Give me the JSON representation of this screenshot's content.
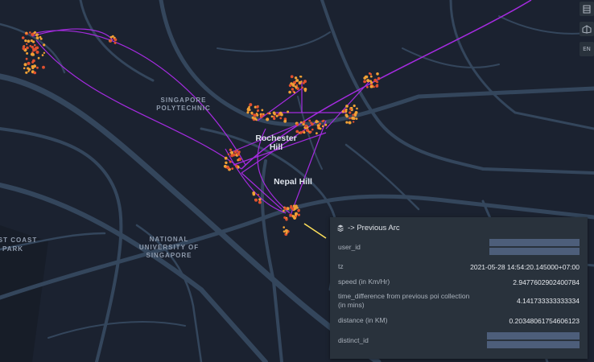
{
  "map": {
    "places": [
      {
        "text": "SINGAPORE",
        "kind": "area"
      },
      {
        "text": "POLYTECHNIC",
        "kind": "area"
      },
      {
        "text": "NATIONAL",
        "kind": "area"
      },
      {
        "text": "UNIVERSITY OF",
        "kind": "area"
      },
      {
        "text": "SINGAPORE",
        "kind": "area"
      },
      {
        "text": "ST COAST",
        "kind": "area"
      },
      {
        "text": "PARK",
        "kind": "area"
      },
      {
        "text": "Rochester",
        "kind": "hill"
      },
      {
        "text": "Hill",
        "kind": "hill"
      },
      {
        "text": "Nepal Hill",
        "kind": "hill"
      }
    ],
    "colors": {
      "background": "#1b2230",
      "roads": "#34465c",
      "arcs": "#a52be0",
      "points": "#f0a035",
      "selected_arc": "#ffe15a"
    }
  },
  "controls": {
    "layers_icon": "layers-icon",
    "map_icon": "map-3d-icon",
    "language": "EN"
  },
  "tooltip": {
    "title": "-> Previous Arc",
    "icon": "layers-icon",
    "rows": [
      {
        "label": "user_id",
        "value": "",
        "redacted": true
      },
      {
        "label": "tz",
        "value": "2021-05-28 14:54:20.145000+07:00"
      },
      {
        "label": "speed (in Km/Hr)",
        "value": "2.9477602902400784"
      },
      {
        "label": "time_difference from previous poi collection (in mins)",
        "value": "4.141733333333334"
      },
      {
        "label": "distance (in KM)",
        "value": "0.20348061754606123"
      },
      {
        "label": "distinct_id",
        "value": "",
        "redacted": true
      }
    ]
  }
}
